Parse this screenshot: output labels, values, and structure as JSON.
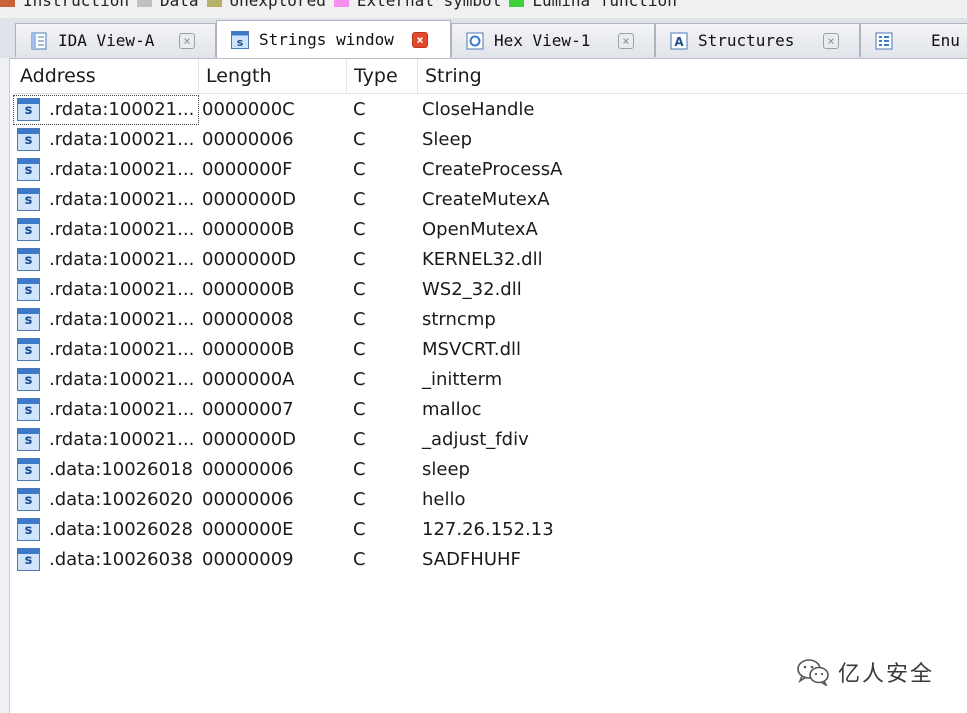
{
  "legend": [
    {
      "label": "Instruction",
      "color": "#c8623a"
    },
    {
      "label": "Data",
      "color": "#c0c0c0"
    },
    {
      "label": "Unexplored",
      "color": "#b5b06a"
    },
    {
      "label": "External symbol",
      "color": "#f58ff0"
    },
    {
      "label": "Lumina function",
      "color": "#3bd23b"
    }
  ],
  "tabs": [
    {
      "label": "IDA View-A",
      "icon": "ida-view-icon",
      "active": false
    },
    {
      "label": "Strings window",
      "icon": "strings-icon",
      "active": true
    },
    {
      "label": "Hex View-1",
      "icon": "hex-view-icon",
      "active": false
    },
    {
      "label": "Structures",
      "icon": "structures-icon",
      "active": false
    },
    {
      "label": "Enu",
      "icon": "enums-icon",
      "active": false
    }
  ],
  "table": {
    "columns": [
      "Address",
      "Length",
      "Type",
      "String"
    ],
    "rows": [
      {
        "address": ".rdata:100021...",
        "length": "0000000C",
        "type": "C",
        "string": "CloseHandle"
      },
      {
        "address": ".rdata:100021...",
        "length": "00000006",
        "type": "C",
        "string": "Sleep"
      },
      {
        "address": ".rdata:100021...",
        "length": "0000000F",
        "type": "C",
        "string": "CreateProcessA"
      },
      {
        "address": ".rdata:100021...",
        "length": "0000000D",
        "type": "C",
        "string": "CreateMutexA"
      },
      {
        "address": ".rdata:100021...",
        "length": "0000000B",
        "type": "C",
        "string": "OpenMutexA"
      },
      {
        "address": ".rdata:100021...",
        "length": "0000000D",
        "type": "C",
        "string": "KERNEL32.dll"
      },
      {
        "address": ".rdata:100021...",
        "length": "0000000B",
        "type": "C",
        "string": "WS2_32.dll"
      },
      {
        "address": ".rdata:100021...",
        "length": "00000008",
        "type": "C",
        "string": "strncmp"
      },
      {
        "address": ".rdata:100021...",
        "length": "0000000B",
        "type": "C",
        "string": "MSVCRT.dll"
      },
      {
        "address": ".rdata:100021...",
        "length": "0000000A",
        "type": "C",
        "string": "_initterm"
      },
      {
        "address": ".rdata:100021...",
        "length": "00000007",
        "type": "C",
        "string": "malloc"
      },
      {
        "address": ".rdata:100021...",
        "length": "0000000D",
        "type": "C",
        "string": "_adjust_fdiv"
      },
      {
        "address": ".data:10026018",
        "length": "00000006",
        "type": "C",
        "string": "sleep"
      },
      {
        "address": ".data:10026020",
        "length": "00000006",
        "type": "C",
        "string": "hello"
      },
      {
        "address": ".data:10026028",
        "length": "0000000E",
        "type": "C",
        "string": "127.26.152.13"
      },
      {
        "address": ".data:10026038",
        "length": "00000009",
        "type": "C",
        "string": "SADFHUHF"
      }
    ]
  },
  "watermark": {
    "label": "亿人安全",
    "icon": "wechat-icon"
  }
}
